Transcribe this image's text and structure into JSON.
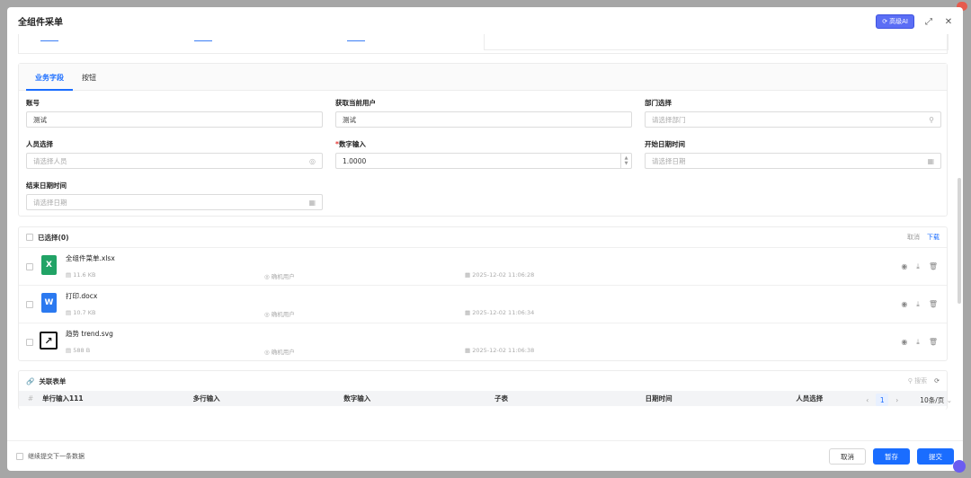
{
  "modal": {
    "title": "全组件采单",
    "ai_label": "高级AI",
    "expand_icon": "expand-icon",
    "close_icon": "close-icon"
  },
  "tabs": [
    {
      "label": "业务字段",
      "active": true
    },
    {
      "label": "按钮",
      "active": false
    }
  ],
  "fields": {
    "account": {
      "label": "账号",
      "value": "测试"
    },
    "current_user": {
      "label": "获取当前用户",
      "value": "测试"
    },
    "department": {
      "label": "部门选择",
      "placeholder": "请选择部门"
    },
    "person": {
      "label": "人员选择",
      "placeholder": "请选择人员"
    },
    "number": {
      "label": "数字输入",
      "value": "1.0000",
      "required": true
    },
    "start_datetime": {
      "label": "开始日期时间",
      "placeholder": "请选择日期"
    },
    "end_datetime": {
      "label": "结束日期时间",
      "placeholder": "请选择日期"
    }
  },
  "files": {
    "selected_label": "已选择(0)",
    "cancel_label": "取消",
    "download_label": "下载",
    "items": [
      {
        "name": "全组件菜单.xlsx",
        "size": "11.6 KB",
        "user": "确机用户",
        "time": "2025-12-02 11:06:28",
        "type": "xls",
        "badge": "X"
      },
      {
        "name": "打印.docx",
        "size": "10.7 KB",
        "user": "确机用户",
        "time": "2025-12-02 11:06:34",
        "type": "doc",
        "badge": "W"
      },
      {
        "name": "趋势 trend.svg",
        "size": "588 B",
        "user": "确机用户",
        "time": "2025-12-02 11:06:38",
        "type": "svg",
        "badge": "↗"
      }
    ]
  },
  "related": {
    "title": "关联表单",
    "search_label": "搜索",
    "columns": [
      "单行输入111",
      "多行输入",
      "数字输入",
      "子表",
      "日期时间",
      "人员选择"
    ]
  },
  "pager": {
    "current": "1",
    "page_size": "10条/页"
  },
  "footer": {
    "continue_label": "继续提交下一条数据",
    "cancel": "取消",
    "save_draft": "暂存",
    "submit": "提交"
  },
  "colors": {
    "accent": "#1a6dff",
    "xls": "#21a366",
    "doc": "#2b79f0"
  }
}
